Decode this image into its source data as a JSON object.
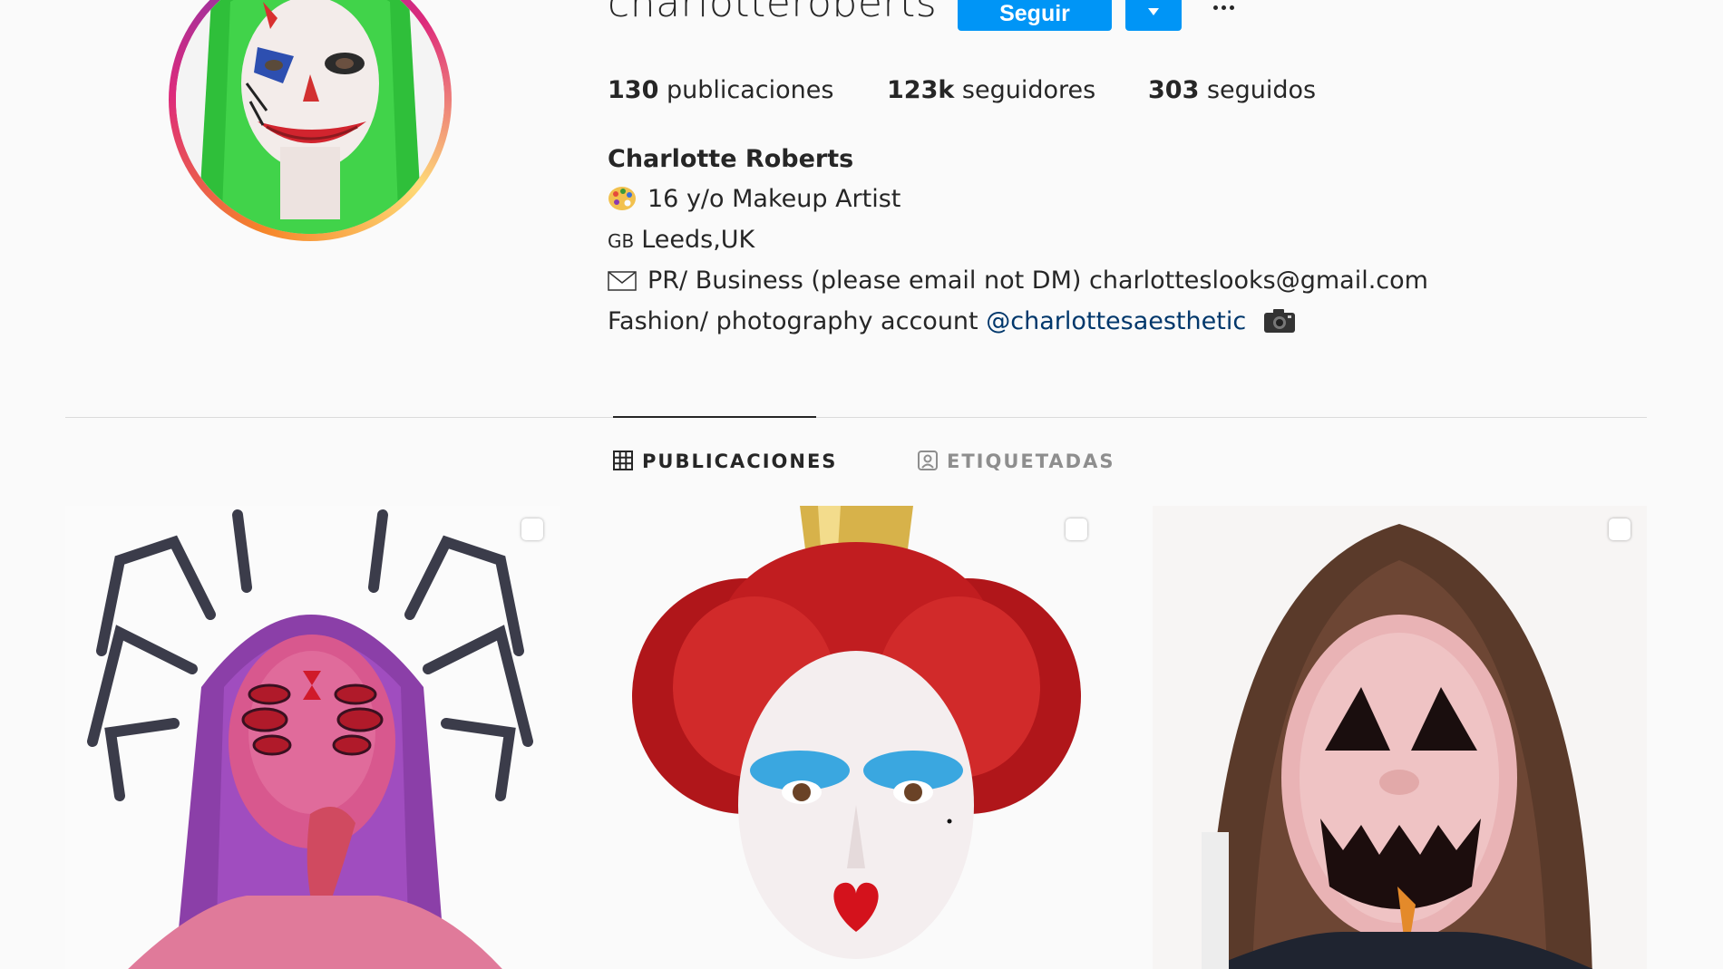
{
  "profile": {
    "username": "charlotteroberts",
    "follow_label": "Seguir",
    "stats": {
      "posts_count": "130",
      "posts_label": "publicaciones",
      "followers_count": "123k",
      "followers_label": "seguidores",
      "following_count": "303",
      "following_label": "seguidos"
    },
    "bio": {
      "name": "Charlotte Roberts",
      "line1": "16 y/o Makeup Artist",
      "flag_text": "GB",
      "line2": "Leeds,UK",
      "line3": "PR/ Business (please email not DM) charlotteslooks@gmail.com",
      "line4_text": "Fashion/ photography account",
      "line4_link": "@charlottesaesthetic"
    }
  },
  "tabs": {
    "posts_label": "PUBLICACIONES",
    "tagged_label": "ETIQUETADAS"
  },
  "icons": {
    "palette": "palette-emoji-icon",
    "envelope": "envelope-icon",
    "camera": "camera-icon",
    "grid": "grid-icon",
    "tagged": "tagged-person-icon",
    "more": "more-options-icon",
    "dropdown": "chevron-down-icon",
    "multi": "multiple-photos-icon"
  },
  "colors": {
    "accent": "#0095f6",
    "link": "#00376b",
    "text": "#262626",
    "muted": "#8e8e8e",
    "background": "#fafafa"
  }
}
